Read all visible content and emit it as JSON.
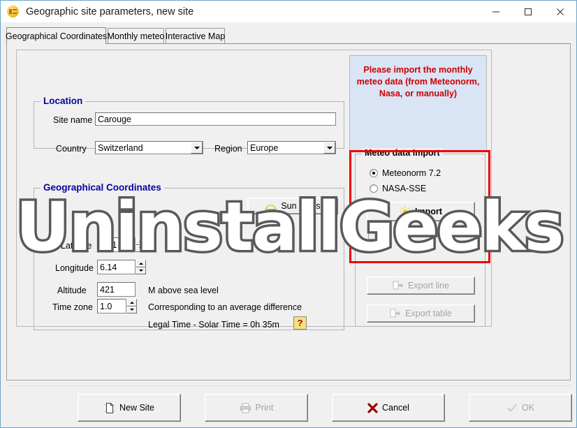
{
  "window": {
    "title": "Geographic site parameters, new site",
    "icon": "app-globe-icon",
    "minimize": "—",
    "maximize": "□",
    "close": "✕"
  },
  "tabs": [
    {
      "label": "Geographical Coordinates",
      "active": true
    },
    {
      "label": "Monthly meteo",
      "active": false
    },
    {
      "label": "Interactive Map",
      "active": false
    }
  ],
  "location": {
    "group_title": "Location",
    "site_name_label": "Site name",
    "site_name_value": "Carouge",
    "country_label": "Country",
    "country_value": "Switzerland",
    "country_selected": true,
    "region_label": "Region",
    "region_value": "Europe"
  },
  "coordinates": {
    "group_title": "Geographical Coordinates",
    "sun_paths_label": "Sun paths",
    "latitude_label": "Latitude",
    "latitude_value": "46.1",
    "longitude_label": "Longitude",
    "longitude_value": "6.14",
    "altitude_label": "Altitude",
    "altitude_value": "421",
    "altitude_unit": "M above sea level",
    "timezone_label": "Time zone",
    "timezone_value": "1.0",
    "timezone_note": "Corresponding to an average difference",
    "legal_time_text": "Legal Time - Solar Time =   0h 35m",
    "help_label": "?"
  },
  "info_panel": {
    "message": "Please import the monthly meteo data (from Meteonorm, Nasa, or manually)",
    "background": "#d9e4f5",
    "text_color": "#cc0000"
  },
  "meteo_import": {
    "group_title": "Meteo data Import",
    "options": [
      {
        "label": "Meteonorm 7.2",
        "selected": true
      },
      {
        "label": "NASA-SSE",
        "selected": false
      }
    ],
    "import_label": "Import",
    "export_line_label": "Export line",
    "export_table_label": "Export table",
    "highlight_color": "#ee0000"
  },
  "footer": {
    "buttons": [
      {
        "label": "New Site",
        "icon": "new-document-icon",
        "disabled": false
      },
      {
        "label": "Print",
        "icon": "printer-icon",
        "disabled": true
      },
      {
        "label": "Cancel",
        "icon": "x-mark-icon",
        "disabled": false
      },
      {
        "label": "OK",
        "icon": "check-mark-icon",
        "disabled": true
      }
    ]
  },
  "watermark": {
    "text": "UninstallGeeks"
  }
}
